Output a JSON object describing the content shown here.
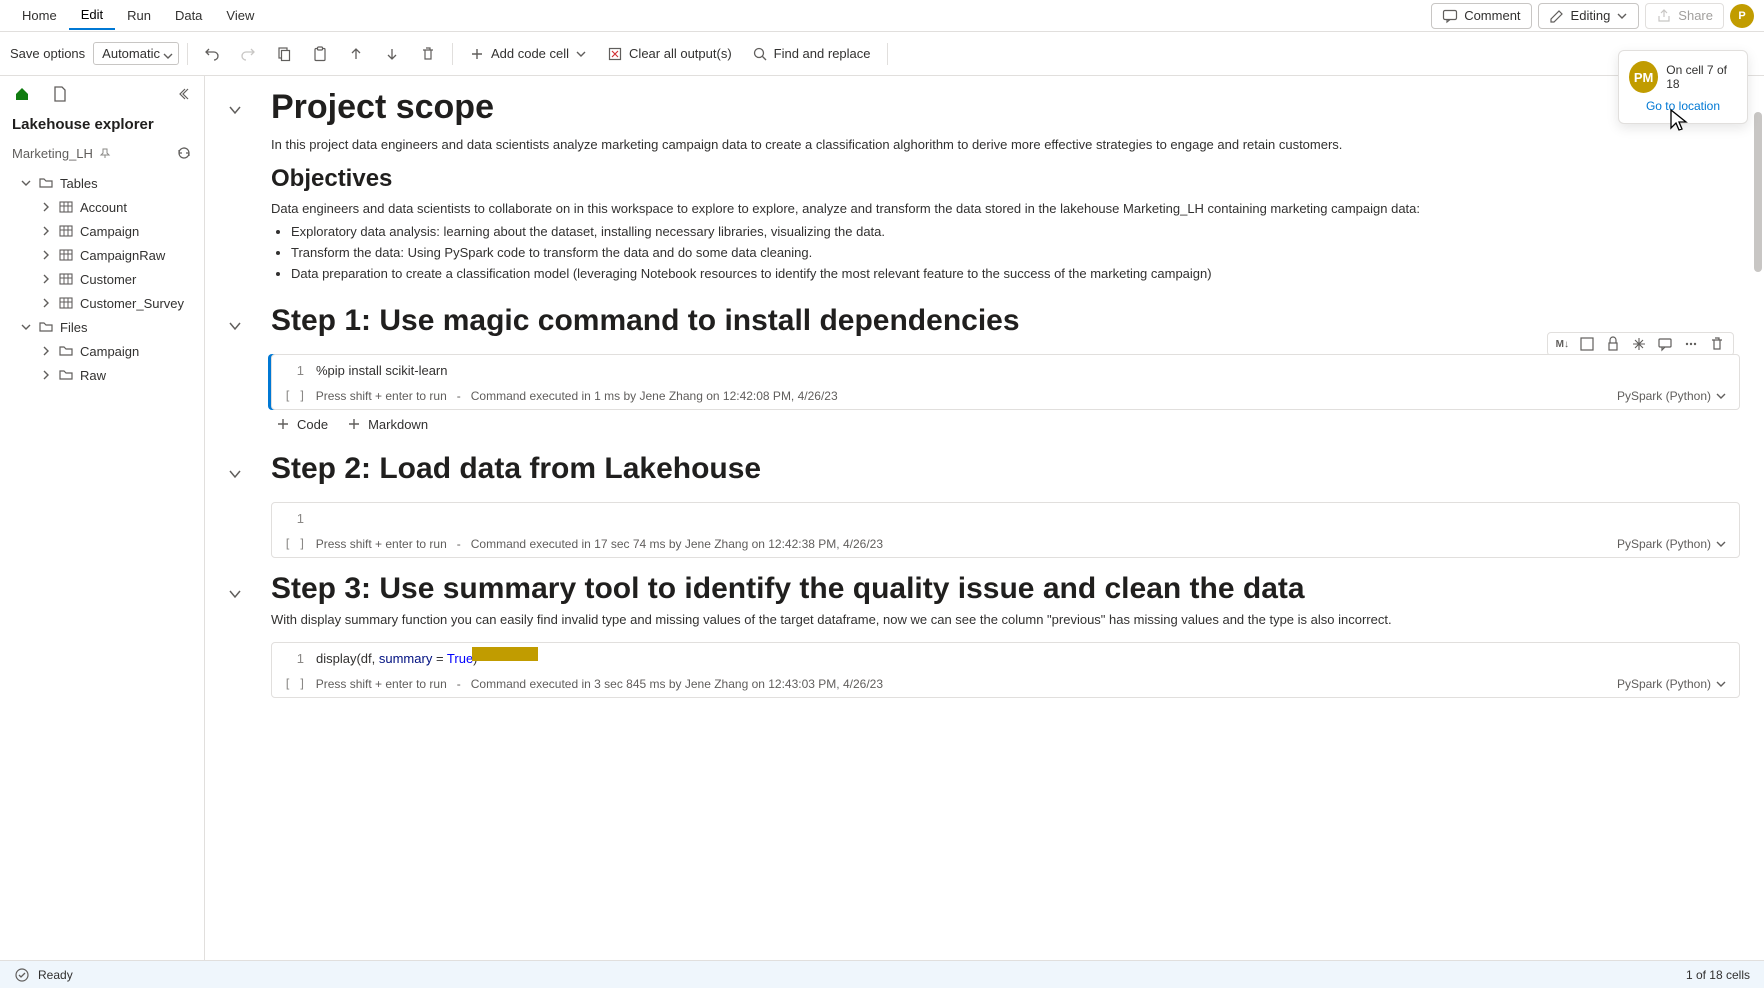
{
  "menu": {
    "home": "Home",
    "edit": "Edit",
    "run": "Run",
    "data": "Data",
    "view": "View"
  },
  "topright": {
    "comment": "Comment",
    "editing": "Editing",
    "share": "Share"
  },
  "toolbar": {
    "save_label": "Save options",
    "save_mode": "Automatic",
    "add_code": "Add code cell",
    "clear_out": "Clear all output(s)",
    "find": "Find and replace"
  },
  "rail": {
    "title": "Lakehouse explorer",
    "lakehouse": "Marketing_LH",
    "tables": "Tables",
    "files": "Files",
    "table_items": [
      "Account",
      "Campaign",
      "CampaignRaw",
      "Customer",
      "Customer_Survey"
    ],
    "file_items": [
      "Campaign",
      "Raw"
    ]
  },
  "doc": {
    "scope_title": "Project scope",
    "scope_p": "In this project data engineers and data scientists analyze marketing campaign data to create a classification alghorithm to derive more effective strategies to engage and retain customers.",
    "obj_title": "Objectives",
    "obj_p": "Data engineers and data scientists to collaborate on in this workspace to explore to explore, analyze and transform the data stored in the lakehouse Marketing_LH containing marketing campaign data:",
    "obj_li1": "Exploratory data analysis: learning about the dataset, installing necessary libraries, visualizing the data.",
    "obj_li2": "Transform the data: Using PySpark code to transform the data and do some data cleaning.",
    "obj_li3": "Data preparation to create a classification model (leveraging Notebook resources to identify the most relevant feature to the success of the marketing campaign)",
    "step1": "Step 1: Use magic command to install dependencies",
    "step2": "Step 2: Load data from Lakehouse",
    "step3": "Step 3: Use summary tool to identify the quality issue and clean the data",
    "step3_p": "With display summary function you can easily find invalid type and missing values of the target dataframe, now we can see the column \"previous\" has missing values and the type is also incorrect."
  },
  "cells": {
    "hint": "Press shift + enter to run",
    "kernel": "PySpark (Python)",
    "c1_code": "%pip install scikit-learn",
    "c1_status": "Command executed in 1 ms by Jene Zhang on 12:42:08 PM, 4/26/23",
    "c2_status": "Command executed in 17 sec 74 ms by Jene Zhang on 12:42:38 PM, 4/26/23",
    "c3_code_pre": "display(df, ",
    "c3_code_param": "summary",
    "c3_code_mid": " = ",
    "c3_code_bool": "True",
    "c3_code_post": ")",
    "c3_status": "Command executed in 3 sec 845 ms by Jene Zhang on 12:43:03 PM, 4/26/23",
    "add_code": "Code",
    "add_md": "Markdown",
    "ln": "1",
    "bracket": "[  ]",
    "toolbar_md": "M↓"
  },
  "presence": {
    "initials": "PM",
    "cell_info": "On cell 7 of 18",
    "goto": "Go to location"
  },
  "status": {
    "ready": "Ready",
    "cells": "1 of 18 cells"
  }
}
